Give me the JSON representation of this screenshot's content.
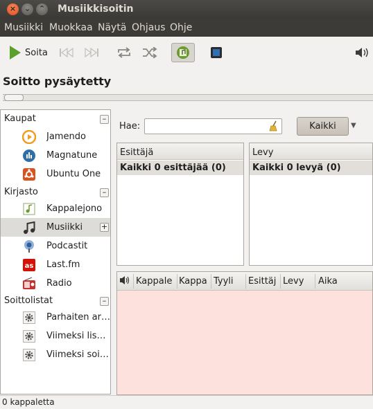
{
  "window": {
    "title": "Musiikkisoitin",
    "close_glyph": "×",
    "min_glyph": "⌄",
    "max_glyph": "⌃"
  },
  "menu": [
    "Musiikki",
    "Muokkaa",
    "Näytä",
    "Ohjaus",
    "Ohje"
  ],
  "toolbar": {
    "play_label": "Soita",
    "prev_icon": "previous-icon",
    "next_icon": "next-icon",
    "repeat_icon": "repeat-icon",
    "shuffle_icon": "shuffle-icon",
    "browser_icon": "browser-icon",
    "visual_icon": "visualization-icon",
    "volume_icon": "volume-icon"
  },
  "status_title": "Soitto pysäytetty",
  "sidebar": {
    "groups": [
      {
        "label": "Kaupat",
        "expander": "–",
        "items": [
          {
            "label": "Jamendo",
            "icon": "jamendo-icon"
          },
          {
            "label": "Magnatune",
            "icon": "magnatune-icon"
          },
          {
            "label": "Ubuntu One",
            "icon": "ubuntu-one-icon"
          }
        ]
      },
      {
        "label": "Kirjasto",
        "expander": "–",
        "items": [
          {
            "label": "Kappalejono",
            "icon": "play-queue-icon"
          },
          {
            "label": "Musiikki",
            "icon": "music-note-icon",
            "selected": true,
            "expander": "+"
          },
          {
            "label": "Podcastit",
            "icon": "podcast-icon"
          },
          {
            "label": "Last.fm",
            "icon": "lastfm-icon"
          },
          {
            "label": "Radio",
            "icon": "radio-icon"
          }
        ]
      },
      {
        "label": "Soittolistat",
        "expander": "–",
        "items": [
          {
            "label": "Parhaiten arvostetut",
            "icon": "gear-icon"
          },
          {
            "label": "Viimeksi lisätyt",
            "icon": "gear-icon"
          },
          {
            "label": "Viimeksi soitetut",
            "icon": "gear-icon"
          }
        ]
      }
    ]
  },
  "search": {
    "label": "Hae:",
    "value": "",
    "clear_icon": "broom-icon",
    "filter_button": "Kaikki",
    "dropdown_glyph": "▼"
  },
  "browser": {
    "artist": {
      "header": "Esittäjä",
      "selected": "Kaikki 0 esittäjää (0)"
    },
    "album": {
      "header": "Levy",
      "selected": "Kaikki 0 levyä (0)"
    }
  },
  "tracklist": {
    "columns": [
      "Kappale",
      "Kappa",
      "Tyyli",
      "Esittäj",
      "Levy",
      "Aika"
    ],
    "rows": []
  },
  "statusbar": "0 kappaletta"
}
